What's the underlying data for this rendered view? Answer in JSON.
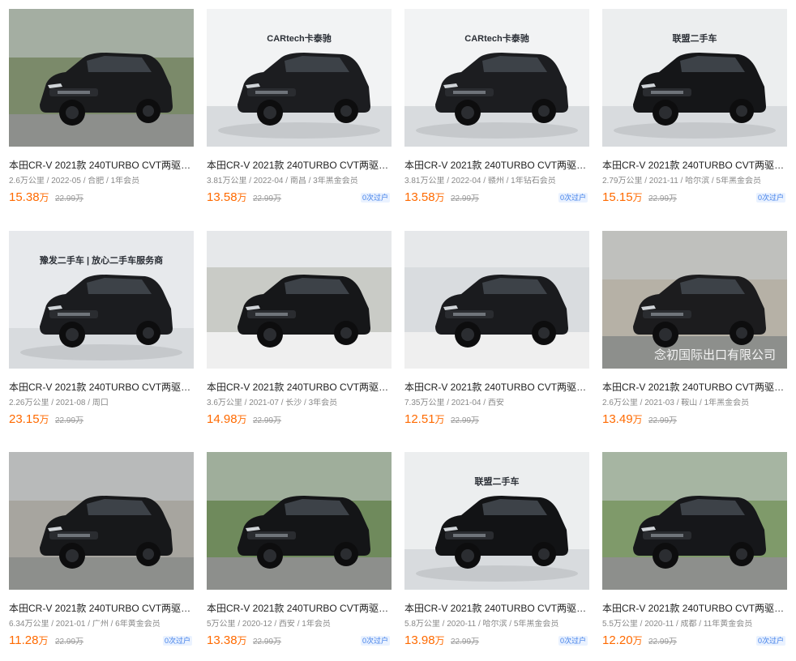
{
  "listings": [
    {
      "title": "本田CR-V 2021款 240TURBO CVT两驱黑...",
      "meta": "2.6万公里 / 2022-05 / 合肥 / 1年会员",
      "price": "15.38",
      "unit": "万",
      "old_price": "22.99万",
      "badge": "",
      "scene": "street",
      "bg": "#7b8a6a",
      "car": "#1a1b1d"
    },
    {
      "title": "本田CR-V 2021款 240TURBO CVT两驱黑...",
      "meta": "3.81万公里 / 2022-04 / 南昌 / 3年黑金会员",
      "price": "13.58",
      "unit": "万",
      "old_price": "22.99万",
      "badge": "0次过户",
      "scene": "studio",
      "bg": "#f2f3f4",
      "car": "#1c1d20",
      "logo": "CARtech卡泰驰"
    },
    {
      "title": "本田CR-V 2021款 240TURBO CVT两驱黑...",
      "meta": "3.81万公里 / 2022-04 / 赣州 / 1年钻石会员",
      "price": "13.58",
      "unit": "万",
      "old_price": "22.99万",
      "badge": "0次过户",
      "scene": "studio",
      "bg": "#f2f3f4",
      "car": "#1c1d20",
      "logo": "CARtech卡泰驰"
    },
    {
      "title": "本田CR-V 2021款 240TURBO CVT两驱黑...",
      "meta": "2.79万公里 / 2021-11 / 哈尔滨 / 5年黑金会员",
      "price": "15.15",
      "unit": "万",
      "old_price": "22.99万",
      "badge": "0次过户",
      "scene": "studio",
      "bg": "#eceeef",
      "car": "#151618",
      "logo": "联盟二手车"
    },
    {
      "title": "本田CR-V 2021款 240TURBO CVT两驱黑...",
      "meta": "2.26万公里 / 2021-08 / 周口",
      "price": "23.15",
      "unit": "万",
      "old_price": "22.99万",
      "badge": "",
      "scene": "studio",
      "bg": "#e7e9ec",
      "car": "#1b1c1f",
      "logo": "豫发二手车 | 放心二手车服务商"
    },
    {
      "title": "本田CR-V 2021款 240TURBO CVT两驱黑...",
      "meta": "3.6万公里 / 2021-07 / 长沙 / 3年会员",
      "price": "14.98",
      "unit": "万",
      "old_price": "22.99万",
      "badge": "",
      "scene": "showroom",
      "bg": "#c9cbc6",
      "car": "#161719"
    },
    {
      "title": "本田CR-V 2021款 240TURBO CVT两驱黑...",
      "meta": "7.35万公里 / 2021-04 / 西安",
      "price": "12.51",
      "unit": "万",
      "old_price": "22.99万",
      "badge": "",
      "scene": "showroom",
      "bg": "#d9dcdf",
      "car": "#1a1b1e"
    },
    {
      "title": "本田CR-V 2021款 240TURBO CVT两驱黑...",
      "meta": "2.6万公里 / 2021-03 / 鞍山 / 1年黑金会员",
      "price": "13.49",
      "unit": "万",
      "old_price": "22.99万",
      "badge": "",
      "scene": "street",
      "bg": "#b6b1a6",
      "car": "#1c1c1e",
      "watermark": "念初国际出口有限公司"
    },
    {
      "title": "本田CR-V 2021款 240TURBO CVT两驱黑...",
      "meta": "6.34万公里 / 2021-01 / 广州 / 6年黄金会员",
      "price": "11.28",
      "unit": "万",
      "old_price": "22.99万",
      "badge": "0次过户",
      "scene": "street",
      "bg": "#a7a59f",
      "car": "#17181a"
    },
    {
      "title": "本田CR-V 2021款 240TURBO CVT两驱黑...",
      "meta": "5万公里 / 2020-12 / 西安 / 1年会员",
      "price": "13.38",
      "unit": "万",
      "old_price": "22.99万",
      "badge": "0次过户",
      "scene": "street",
      "bg": "#6f8a5c",
      "car": "#141517"
    },
    {
      "title": "本田CR-V 2021款 240TURBO CVT两驱黑...",
      "meta": "5.8万公里 / 2020-11 / 哈尔滨 / 5年黑金会员",
      "price": "13.98",
      "unit": "万",
      "old_price": "22.99万",
      "badge": "0次过户",
      "scene": "studio",
      "bg": "#eceeef",
      "car": "#121315",
      "logo": "联盟二手车"
    },
    {
      "title": "本田CR-V 2021款 240TURBO CVT两驱黑...",
      "meta": "5.5万公里 / 2020-11 / 成都 / 11年黄金会员",
      "price": "12.20",
      "unit": "万",
      "old_price": "22.99万",
      "badge": "0次过户",
      "scene": "street",
      "bg": "#7f9a6a",
      "car": "#16171a"
    }
  ]
}
